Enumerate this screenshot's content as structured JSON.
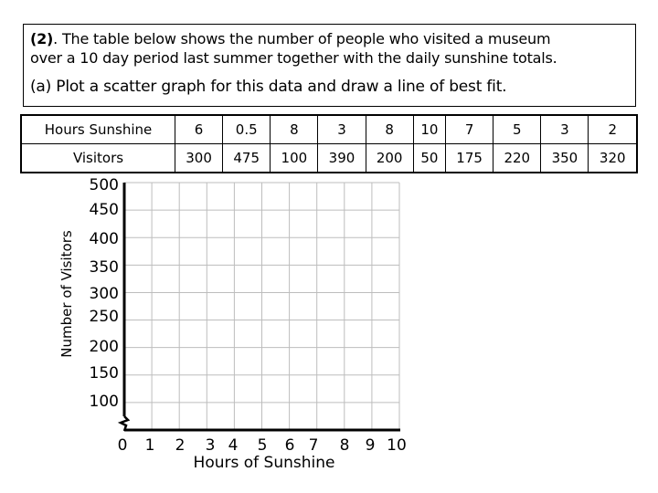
{
  "question": {
    "number": "(2)",
    "text_line1": ". The table below shows the number of people who visited a museum",
    "text_line2": "over a 10 day period last summer together with the daily sunshine totals.",
    "part_a": "(a) Plot a scatter graph for this data and draw a line of best fit."
  },
  "table": {
    "row_headers": [
      "Hours Sunshine",
      "Visitors"
    ],
    "hours_sunshine": [
      "6",
      "0.5",
      "8",
      "3",
      "8",
      "10",
      "7",
      "5",
      "3",
      "2"
    ],
    "visitors": [
      "300",
      "475",
      "100",
      "390",
      "200",
      "50",
      "175",
      "220",
      "350",
      "320"
    ]
  },
  "chart_data": {
    "type": "scatter",
    "title": "",
    "xlabel": "Hours of Sunshine",
    "ylabel": "Number of Visitors",
    "x_ticks": [
      "0",
      "1",
      "2",
      "3",
      "4",
      "5",
      "6",
      "7",
      "8",
      "9",
      "10"
    ],
    "y_ticks": [
      "500",
      "450",
      "400",
      "350",
      "300",
      "250",
      "200",
      "150",
      "100"
    ],
    "xlim": [
      0,
      10
    ],
    "ylim": [
      50,
      500
    ],
    "y_axis_break": true,
    "grid": true,
    "points": [],
    "note": "Empty grid for plotting; data given in table"
  }
}
